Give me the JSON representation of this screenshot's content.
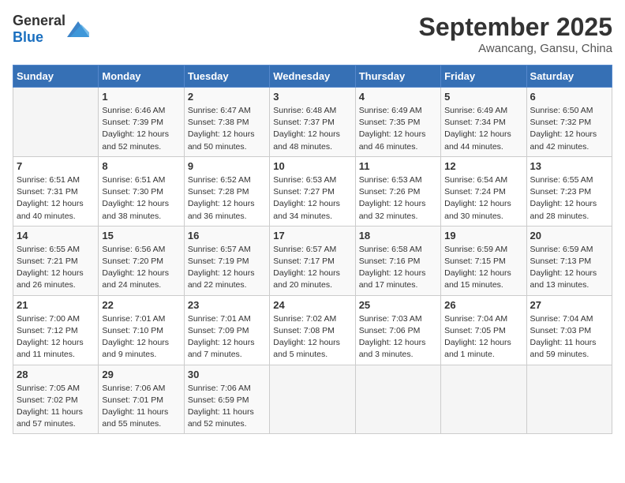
{
  "header": {
    "logo_general": "General",
    "logo_blue": "Blue",
    "month": "September 2025",
    "location": "Awancang, Gansu, China"
  },
  "days_of_week": [
    "Sunday",
    "Monday",
    "Tuesday",
    "Wednesday",
    "Thursday",
    "Friday",
    "Saturday"
  ],
  "weeks": [
    [
      {
        "day": "",
        "detail": ""
      },
      {
        "day": "1",
        "detail": "Sunrise: 6:46 AM\nSunset: 7:39 PM\nDaylight: 12 hours\nand 52 minutes."
      },
      {
        "day": "2",
        "detail": "Sunrise: 6:47 AM\nSunset: 7:38 PM\nDaylight: 12 hours\nand 50 minutes."
      },
      {
        "day": "3",
        "detail": "Sunrise: 6:48 AM\nSunset: 7:37 PM\nDaylight: 12 hours\nand 48 minutes."
      },
      {
        "day": "4",
        "detail": "Sunrise: 6:49 AM\nSunset: 7:35 PM\nDaylight: 12 hours\nand 46 minutes."
      },
      {
        "day": "5",
        "detail": "Sunrise: 6:49 AM\nSunset: 7:34 PM\nDaylight: 12 hours\nand 44 minutes."
      },
      {
        "day": "6",
        "detail": "Sunrise: 6:50 AM\nSunset: 7:32 PM\nDaylight: 12 hours\nand 42 minutes."
      }
    ],
    [
      {
        "day": "7",
        "detail": "Sunrise: 6:51 AM\nSunset: 7:31 PM\nDaylight: 12 hours\nand 40 minutes."
      },
      {
        "day": "8",
        "detail": "Sunrise: 6:51 AM\nSunset: 7:30 PM\nDaylight: 12 hours\nand 38 minutes."
      },
      {
        "day": "9",
        "detail": "Sunrise: 6:52 AM\nSunset: 7:28 PM\nDaylight: 12 hours\nand 36 minutes."
      },
      {
        "day": "10",
        "detail": "Sunrise: 6:53 AM\nSunset: 7:27 PM\nDaylight: 12 hours\nand 34 minutes."
      },
      {
        "day": "11",
        "detail": "Sunrise: 6:53 AM\nSunset: 7:26 PM\nDaylight: 12 hours\nand 32 minutes."
      },
      {
        "day": "12",
        "detail": "Sunrise: 6:54 AM\nSunset: 7:24 PM\nDaylight: 12 hours\nand 30 minutes."
      },
      {
        "day": "13",
        "detail": "Sunrise: 6:55 AM\nSunset: 7:23 PM\nDaylight: 12 hours\nand 28 minutes."
      }
    ],
    [
      {
        "day": "14",
        "detail": "Sunrise: 6:55 AM\nSunset: 7:21 PM\nDaylight: 12 hours\nand 26 minutes."
      },
      {
        "day": "15",
        "detail": "Sunrise: 6:56 AM\nSunset: 7:20 PM\nDaylight: 12 hours\nand 24 minutes."
      },
      {
        "day": "16",
        "detail": "Sunrise: 6:57 AM\nSunset: 7:19 PM\nDaylight: 12 hours\nand 22 minutes."
      },
      {
        "day": "17",
        "detail": "Sunrise: 6:57 AM\nSunset: 7:17 PM\nDaylight: 12 hours\nand 20 minutes."
      },
      {
        "day": "18",
        "detail": "Sunrise: 6:58 AM\nSunset: 7:16 PM\nDaylight: 12 hours\nand 17 minutes."
      },
      {
        "day": "19",
        "detail": "Sunrise: 6:59 AM\nSunset: 7:15 PM\nDaylight: 12 hours\nand 15 minutes."
      },
      {
        "day": "20",
        "detail": "Sunrise: 6:59 AM\nSunset: 7:13 PM\nDaylight: 12 hours\nand 13 minutes."
      }
    ],
    [
      {
        "day": "21",
        "detail": "Sunrise: 7:00 AM\nSunset: 7:12 PM\nDaylight: 12 hours\nand 11 minutes."
      },
      {
        "day": "22",
        "detail": "Sunrise: 7:01 AM\nSunset: 7:10 PM\nDaylight: 12 hours\nand 9 minutes."
      },
      {
        "day": "23",
        "detail": "Sunrise: 7:01 AM\nSunset: 7:09 PM\nDaylight: 12 hours\nand 7 minutes."
      },
      {
        "day": "24",
        "detail": "Sunrise: 7:02 AM\nSunset: 7:08 PM\nDaylight: 12 hours\nand 5 minutes."
      },
      {
        "day": "25",
        "detail": "Sunrise: 7:03 AM\nSunset: 7:06 PM\nDaylight: 12 hours\nand 3 minutes."
      },
      {
        "day": "26",
        "detail": "Sunrise: 7:04 AM\nSunset: 7:05 PM\nDaylight: 12 hours\nand 1 minute."
      },
      {
        "day": "27",
        "detail": "Sunrise: 7:04 AM\nSunset: 7:03 PM\nDaylight: 11 hours\nand 59 minutes."
      }
    ],
    [
      {
        "day": "28",
        "detail": "Sunrise: 7:05 AM\nSunset: 7:02 PM\nDaylight: 11 hours\nand 57 minutes."
      },
      {
        "day": "29",
        "detail": "Sunrise: 7:06 AM\nSunset: 7:01 PM\nDaylight: 11 hours\nand 55 minutes."
      },
      {
        "day": "30",
        "detail": "Sunrise: 7:06 AM\nSunset: 6:59 PM\nDaylight: 11 hours\nand 52 minutes."
      },
      {
        "day": "",
        "detail": ""
      },
      {
        "day": "",
        "detail": ""
      },
      {
        "day": "",
        "detail": ""
      },
      {
        "day": "",
        "detail": ""
      }
    ]
  ]
}
